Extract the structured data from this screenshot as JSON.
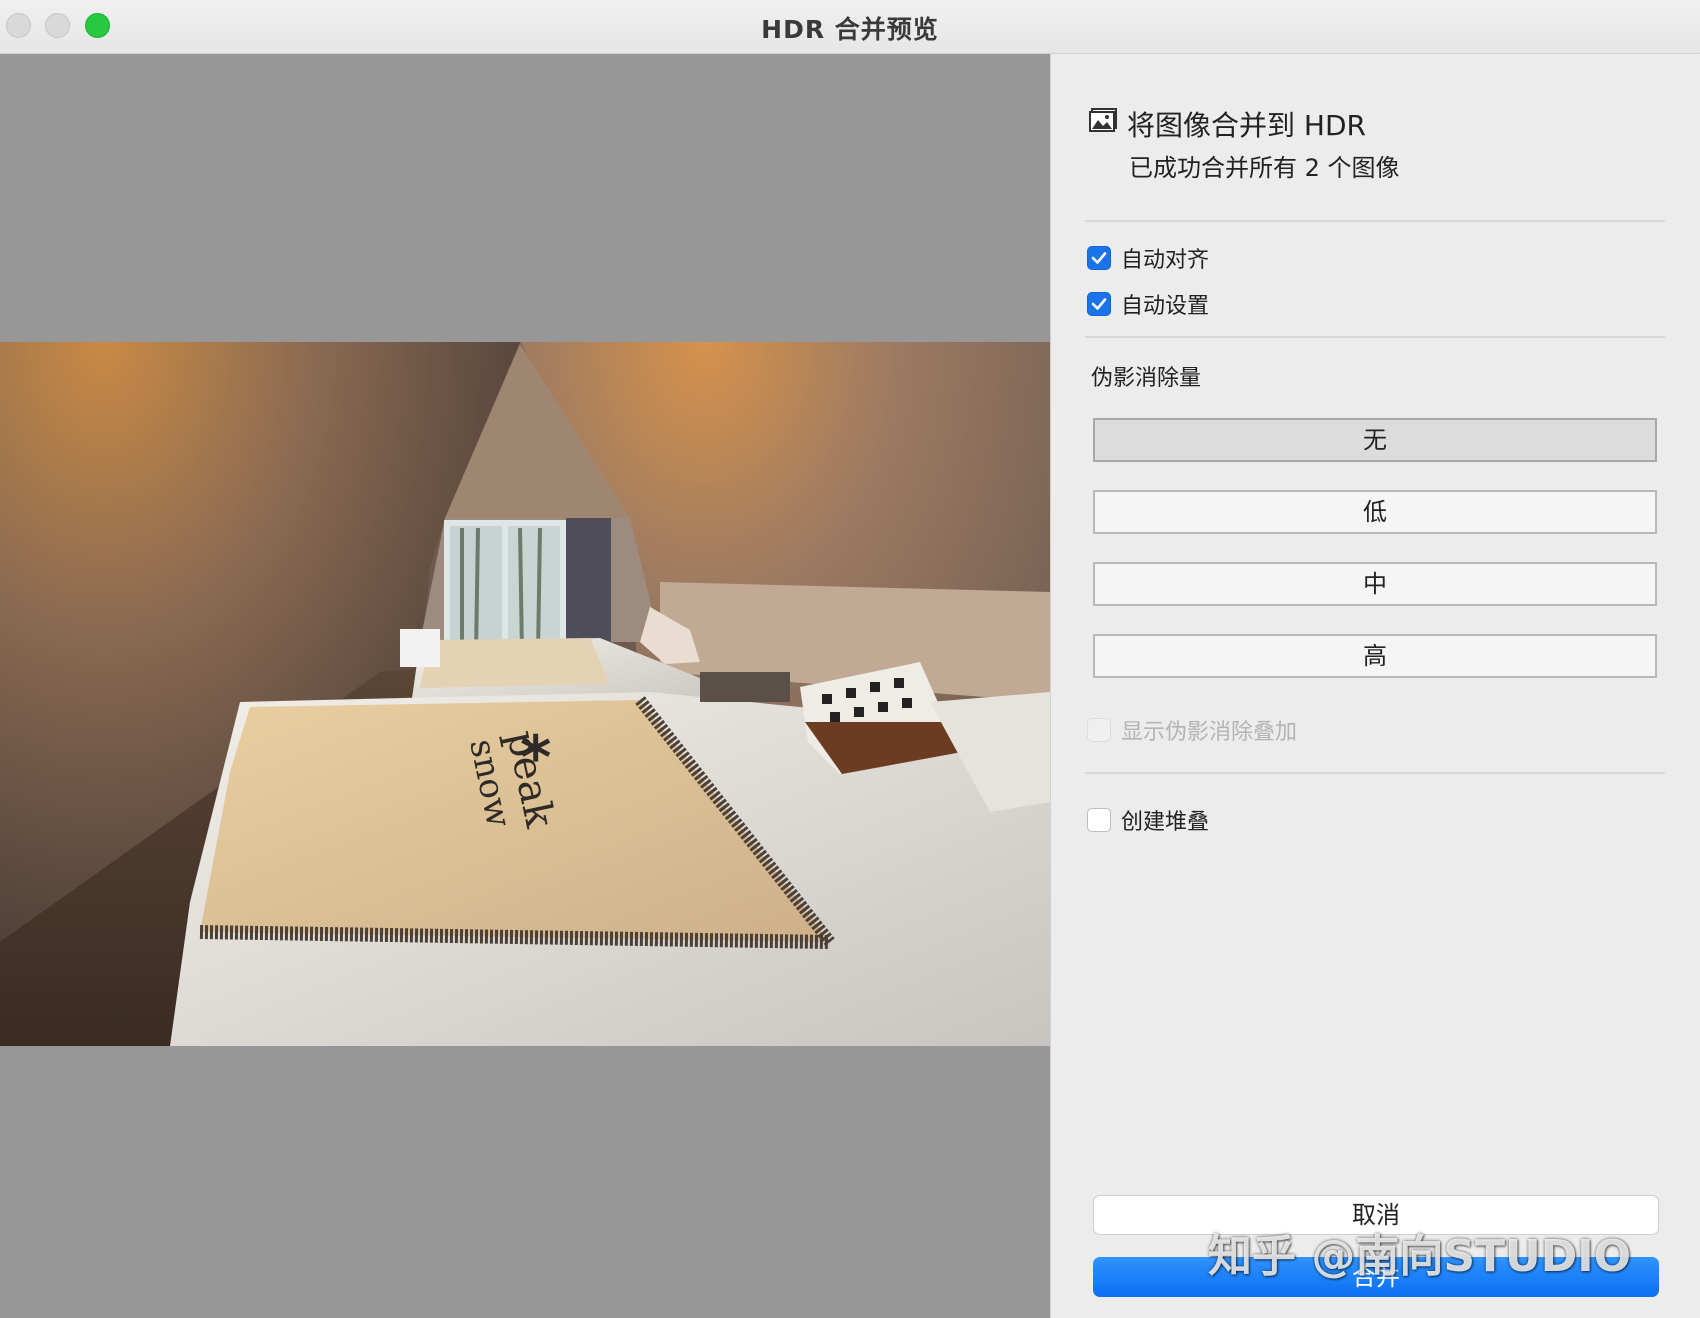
{
  "window": {
    "title": "HDR 合并预览"
  },
  "panel": {
    "merge_title": "将图像合并到 HDR",
    "merge_subtitle": "已成功合并所有 2 个图像",
    "options": {
      "auto_align": {
        "label": "自动对齐",
        "checked": true
      },
      "auto_settings": {
        "label": "自动设置",
        "checked": true
      }
    },
    "deghost": {
      "label": "伪影消除量",
      "buttons": [
        {
          "label": "无",
          "selected": true
        },
        {
          "label": "低",
          "selected": false
        },
        {
          "label": "中",
          "selected": false
        },
        {
          "label": "高",
          "selected": false
        }
      ],
      "overlay": {
        "label": "显示伪影消除叠加",
        "checked": false,
        "disabled": true
      }
    },
    "create_stack": {
      "label": "创建堆叠",
      "checked": false
    },
    "cancel_label": "取消",
    "merge_label": "合并"
  },
  "preview": {
    "photo_text": {
      "brand_line1": "snow",
      "brand_line2": "peak",
      "brand_mark": "*"
    }
  },
  "watermark": "知乎 @南向STUDIO",
  "colors": {
    "accent": "#1a73e8",
    "zoom_button": "#27c93f",
    "preview_background": "#979797"
  }
}
